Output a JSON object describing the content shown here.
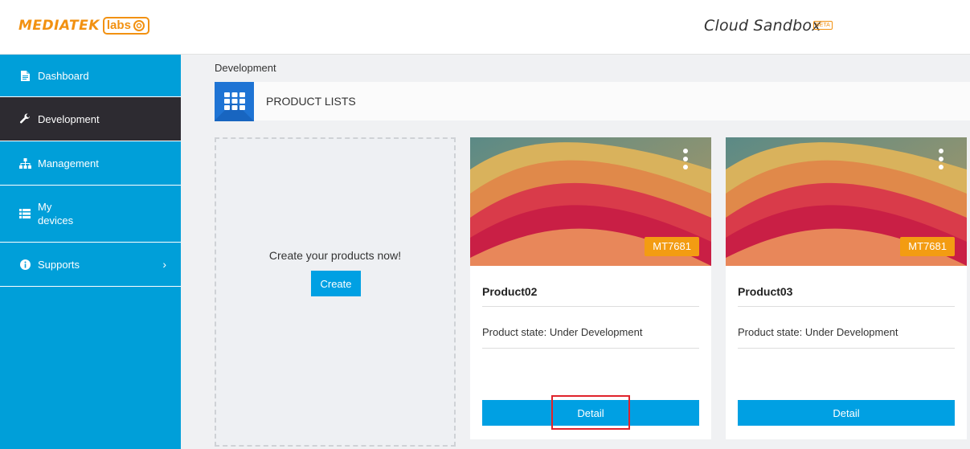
{
  "header": {
    "logo_text": "MEDIATEK",
    "logo_labs": "labs",
    "app_title": "Cloud Sandbox",
    "beta_badge": "BETA"
  },
  "sidebar": {
    "items": [
      {
        "label": "Dashboard",
        "icon": "document-icon"
      },
      {
        "label": "Development",
        "icon": "wrench-icon",
        "active": true
      },
      {
        "label": "Management",
        "icon": "sitemap-icon"
      },
      {
        "label_line1": "My",
        "label_line2": "devices",
        "icon": "list-icon"
      },
      {
        "label": "Supports",
        "icon": "info-icon",
        "chevron": "›"
      }
    ]
  },
  "breadcrumb": "Development",
  "section": {
    "title": "PRODUCT LISTS",
    "icon": "grid-icon"
  },
  "create_panel": {
    "text": "Create your products now!",
    "button": "Create"
  },
  "products": [
    {
      "name": "Product02",
      "chip": "MT7681",
      "state": "Product state: Under Development",
      "button": "Detail"
    },
    {
      "name": "Product03",
      "chip": "MT7681",
      "state": "Product state: Under Development",
      "button": "Detail"
    }
  ],
  "colors": {
    "accent": "#009fd9",
    "active_nav": "#2d2b31",
    "chip": "#f39c12",
    "brand": "#f29111",
    "highlight": "#e0232b"
  }
}
